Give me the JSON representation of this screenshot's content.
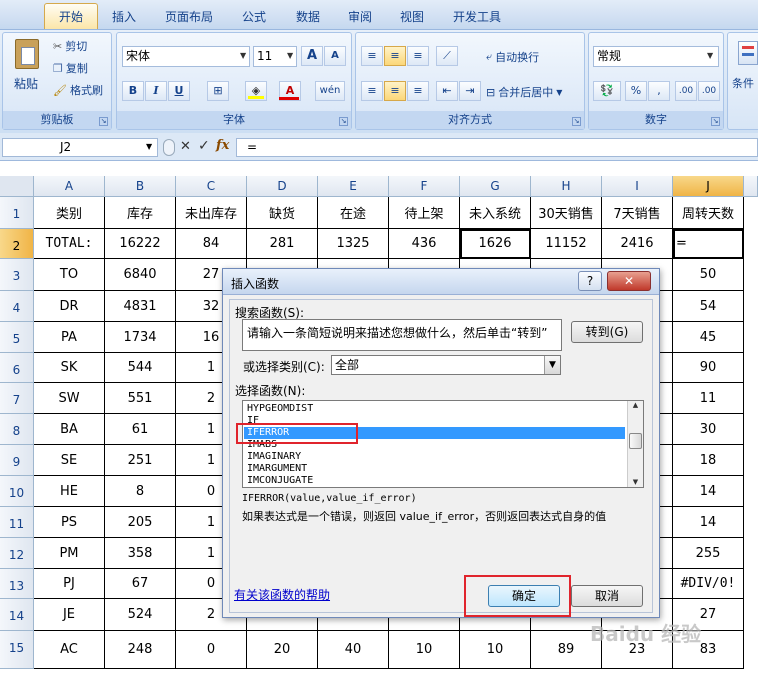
{
  "tabs": [
    "开始",
    "插入",
    "页面布局",
    "公式",
    "数据",
    "审阅",
    "视图",
    "开发工具"
  ],
  "ribbon": {
    "clipboard": {
      "paste": "粘贴",
      "cut": "剪切",
      "copy": "复制",
      "format_painter": "格式刷",
      "name": "剪贴板"
    },
    "font": {
      "family": "宋体",
      "size": "11",
      "grow": "A",
      "shrink": "A",
      "bold": "B",
      "italic": "I",
      "underline": "U",
      "font_color": "A",
      "phonetic": "wén",
      "name": "字体"
    },
    "alignment": {
      "wrap": "自动换行",
      "merge": "合并后居中",
      "name": "对齐方式"
    },
    "number": {
      "format": "常规",
      "percent": "%",
      "comma": ",",
      "inc_decimal": ".00",
      "dec_decimal": ".00",
      "name": "数字"
    },
    "styles": {
      "conditional": "条件"
    }
  },
  "formula_bar": {
    "name_box": "J2",
    "cancel": "✕",
    "enter": "✓",
    "fx": "fx",
    "content": "="
  },
  "sheet": {
    "columns": [
      "A",
      "B",
      "C",
      "D",
      "E",
      "F",
      "G",
      "H",
      "I",
      "J"
    ],
    "rows": [
      {
        "num": "1",
        "cells": [
          "类别",
          "库存",
          "未出库存",
          "缺货",
          "在途",
          "待上架",
          "未入系统",
          "30天销售",
          "7天销售",
          "周转天数"
        ]
      },
      {
        "num": "2",
        "cells": [
          "TOTAL:",
          "16222",
          "84",
          "281",
          "1325",
          "436",
          "1626",
          "11152",
          "2416",
          "="
        ]
      },
      {
        "num": "3",
        "cells": [
          "TO",
          "6840",
          "27",
          "",
          "",
          "",
          "",
          "",
          "",
          "50"
        ]
      },
      {
        "num": "4",
        "cells": [
          "DR",
          "4831",
          "32",
          "",
          "",
          "",
          "",
          "",
          "",
          "54"
        ]
      },
      {
        "num": "5",
        "cells": [
          "PA",
          "1734",
          "16",
          "",
          "",
          "",
          "",
          "",
          "",
          "45"
        ]
      },
      {
        "num": "6",
        "cells": [
          "SK",
          "544",
          "1",
          "",
          "",
          "",
          "",
          "",
          "",
          "90"
        ]
      },
      {
        "num": "7",
        "cells": [
          "SW",
          "551",
          "2",
          "",
          "",
          "",
          "",
          "",
          "",
          "11"
        ]
      },
      {
        "num": "8",
        "cells": [
          "BA",
          "61",
          "1",
          "",
          "",
          "",
          "",
          "",
          "",
          "30"
        ]
      },
      {
        "num": "9",
        "cells": [
          "SE",
          "251",
          "1",
          "",
          "",
          "",
          "",
          "",
          "",
          "18"
        ]
      },
      {
        "num": "10",
        "cells": [
          "HE",
          "8",
          "0",
          "",
          "",
          "",
          "",
          "",
          "",
          "14"
        ]
      },
      {
        "num": "11",
        "cells": [
          "PS",
          "205",
          "1",
          "",
          "",
          "",
          "",
          "",
          "",
          "14"
        ]
      },
      {
        "num": "12",
        "cells": [
          "PM",
          "358",
          "1",
          "",
          "",
          "",
          "",
          "",
          "",
          "255"
        ]
      },
      {
        "num": "13",
        "cells": [
          "PJ",
          "67",
          "0",
          "",
          "",
          "",
          "",
          "",
          "",
          "#DIV/0!"
        ]
      },
      {
        "num": "14",
        "cells": [
          "JE",
          "524",
          "2",
          "",
          "",
          "",
          "",
          "",
          "",
          "27"
        ]
      },
      {
        "num": "15",
        "cells": [
          "AC",
          "248",
          "0",
          "20",
          "40",
          "10",
          "10",
          "89",
          "23",
          "83"
        ]
      }
    ]
  },
  "dialog": {
    "title": "插入函数",
    "help": "?",
    "close": "✕",
    "search_label": "搜索函数(S):",
    "search_text": "请输入一条简短说明来描述您想做什么，然后单击“转到”",
    "go_button": "转到(G)",
    "category_label": "或选择类别(C):",
    "category_value": "全部",
    "select_label": "选择函数(N):",
    "functions": [
      "HYPGEOMDIST",
      "IF",
      "IFERROR",
      "IMABS",
      "IMAGINARY",
      "IMARGUMENT",
      "IMCONJUGATE"
    ],
    "selected_index": 2,
    "signature": "IFERROR(value,value_if_error)",
    "description": "如果表达式是一个错误，则返回 value_if_error，否则返回表达式自身的值",
    "help_link": "有关该函数的帮助",
    "ok": "确定",
    "cancel": "取消"
  },
  "watermark": "Baidu 经验"
}
